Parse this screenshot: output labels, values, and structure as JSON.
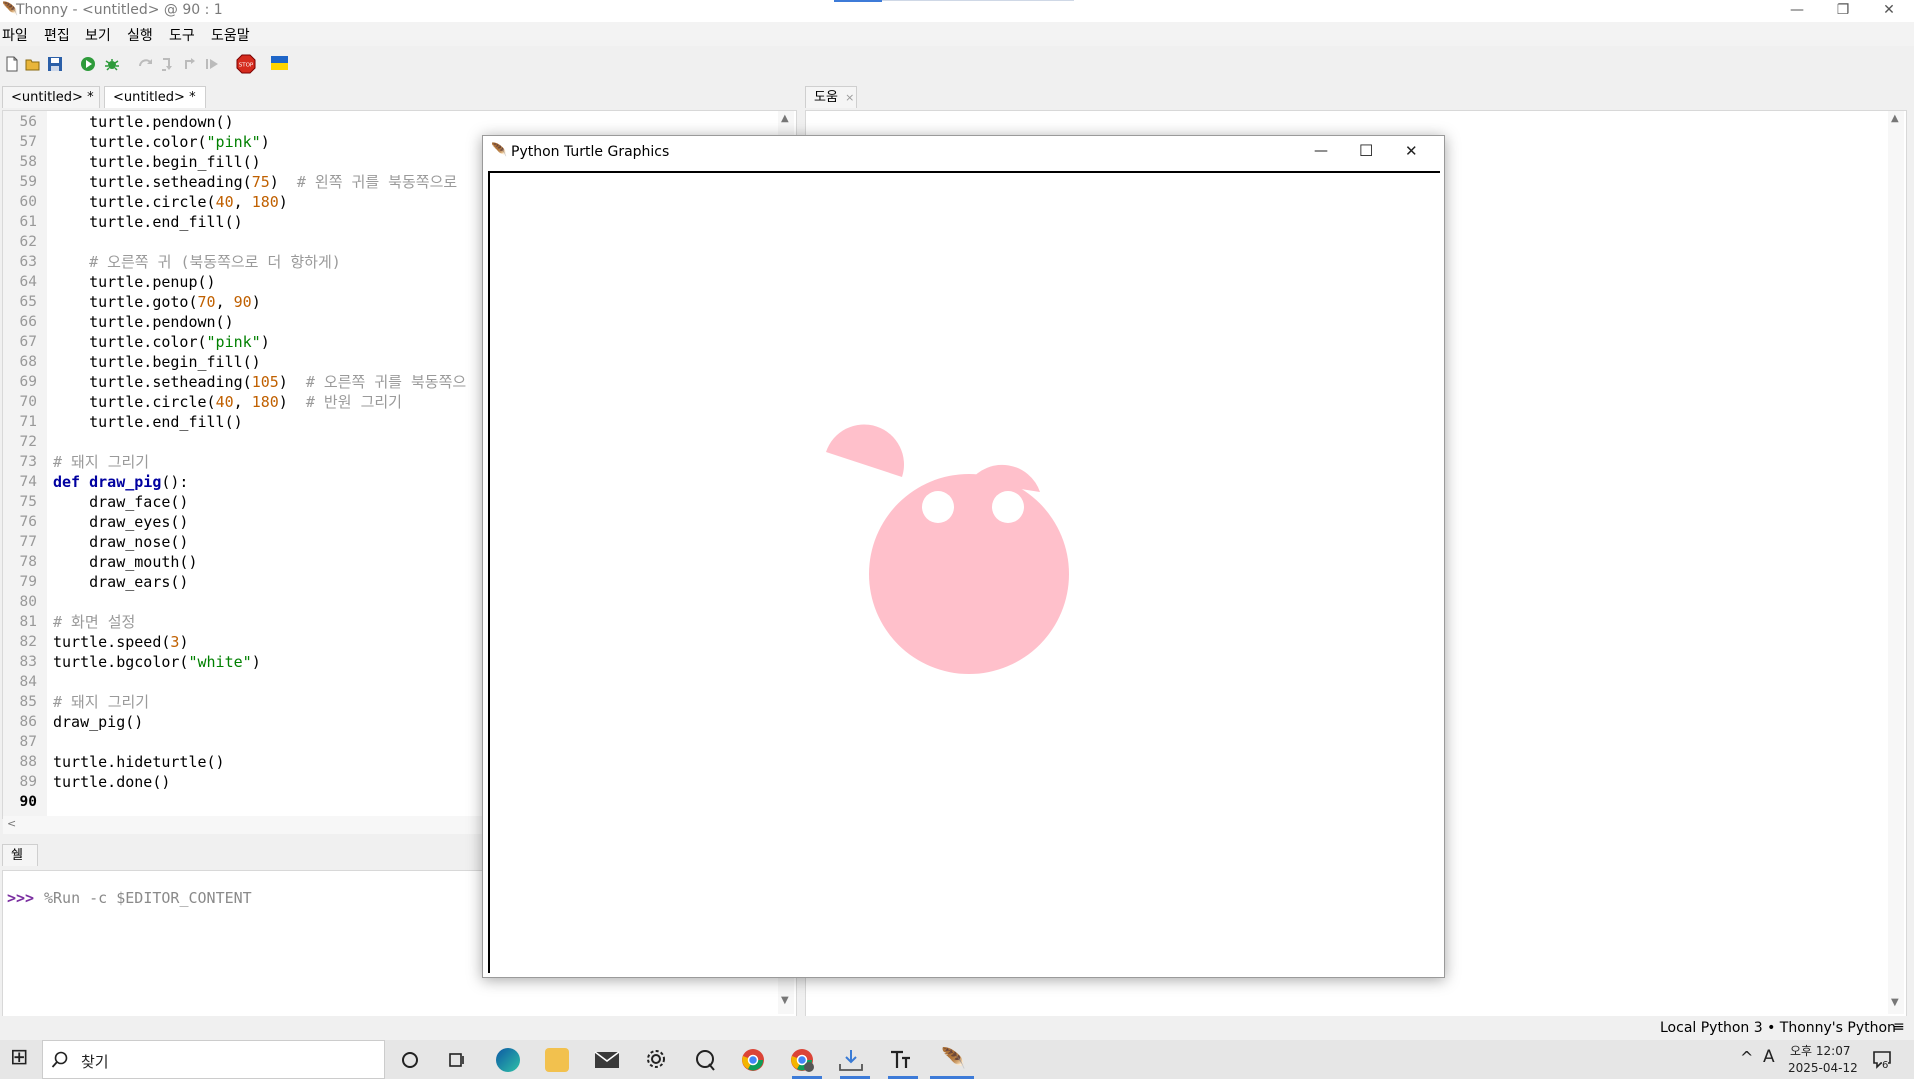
{
  "window": {
    "title": "Thonny  -  <untitled>  @  90 : 1",
    "minimize": "—",
    "restore": "❐",
    "close": "✕"
  },
  "menu": [
    "파일",
    "편집",
    "보기",
    "실행",
    "도구",
    "도움말"
  ],
  "toolbar": {
    "icons": [
      "new-file-icon",
      "open-file-icon",
      "save-icon",
      "run-icon",
      "debug-icon",
      "step-over-icon",
      "step-into-icon",
      "step-out-icon",
      "resume-icon",
      "stop-icon",
      "ukraine-flag-icon"
    ],
    "stop_text": "STOP"
  },
  "editor_tabs": [
    {
      "label": "<untitled> *",
      "close": "×"
    },
    {
      "label": "<untitled> *",
      "close": "×"
    }
  ],
  "help_tab": {
    "label": "도움",
    "close": "×"
  },
  "editor": {
    "lines": [
      {
        "n": "56",
        "html": "    turtle.pendown()"
      },
      {
        "n": "57",
        "html": "    turtle.color(<span class='str'>\"pink\"</span>)"
      },
      {
        "n": "58",
        "html": "    turtle.begin_fill()"
      },
      {
        "n": "59",
        "html": "    turtle.setheading(<span class='num'>75</span>)  <span class='com'># 왼쪽 귀를 북동쪽으로</span>"
      },
      {
        "n": "60",
        "html": "    turtle.circle(<span class='num'>40</span>, <span class='num'>180</span>)"
      },
      {
        "n": "61",
        "html": "    turtle.end_fill()"
      },
      {
        "n": "62",
        "html": ""
      },
      {
        "n": "63",
        "html": "    <span class='com'># 오른쪽 귀 (북동쪽으로 더 향하게)</span>"
      },
      {
        "n": "64",
        "html": "    turtle.penup()"
      },
      {
        "n": "65",
        "html": "    turtle.goto(<span class='num'>70</span>, <span class='num'>90</span>)"
      },
      {
        "n": "66",
        "html": "    turtle.pendown()"
      },
      {
        "n": "67",
        "html": "    turtle.color(<span class='str'>\"pink\"</span>)"
      },
      {
        "n": "68",
        "html": "    turtle.begin_fill()"
      },
      {
        "n": "69",
        "html": "    turtle.setheading(<span class='num'>105</span>)  <span class='com'># 오른쪽 귀를 북동쪽으</span>"
      },
      {
        "n": "70",
        "html": "    turtle.circle(<span class='num'>40</span>, <span class='num'>180</span>)  <span class='com'># 반원 그리기</span>"
      },
      {
        "n": "71",
        "html": "    turtle.end_fill()"
      },
      {
        "n": "72",
        "html": ""
      },
      {
        "n": "73",
        "html": "<span class='com'># 돼지 그리기</span>"
      },
      {
        "n": "74",
        "html": "<span class='kw'>def</span> <span class='fn'>draw_pig</span>():"
      },
      {
        "n": "75",
        "html": "    draw_face()"
      },
      {
        "n": "76",
        "html": "    draw_eyes()"
      },
      {
        "n": "77",
        "html": "    draw_nose()"
      },
      {
        "n": "78",
        "html": "    draw_mouth()"
      },
      {
        "n": "79",
        "html": "    draw_ears()"
      },
      {
        "n": "80",
        "html": ""
      },
      {
        "n": "81",
        "html": "<span class='com'># 화면 설정</span>"
      },
      {
        "n": "82",
        "html": "turtle.speed(<span class='num'>3</span>)"
      },
      {
        "n": "83",
        "html": "turtle.bgcolor(<span class='str'>\"white\"</span>)"
      },
      {
        "n": "84",
        "html": ""
      },
      {
        "n": "85",
        "html": "<span class='com'># 돼지 그리기</span>"
      },
      {
        "n": "86",
        "html": "draw_pig()"
      },
      {
        "n": "87",
        "html": ""
      },
      {
        "n": "88",
        "html": "turtle.hideturtle()"
      },
      {
        "n": "89",
        "html": "turtle.done()"
      },
      {
        "n": "90",
        "html": ""
      }
    ]
  },
  "shell_tab": {
    "label": "쉘",
    "close": "×"
  },
  "shell": {
    "prompt": ">>>",
    "command": "%Run -c $EDITOR_CONTENT"
  },
  "turtle_window": {
    "title": "Python Turtle Graphics",
    "minimize": "—",
    "maximize": "☐",
    "close": "✕",
    "pig_color": "#ffc0cb"
  },
  "statusbar": {
    "interpreter": "Local Python 3  •  Thonny's Python",
    "menu": "≡"
  },
  "taskbar": {
    "start": "⊞",
    "search_placeholder": "찾기",
    "search_icon": "search-icon",
    "time": "오후 12:07",
    "date": "2025-04-12",
    "ime": "A",
    "tray_arrow": "^",
    "notifications": "6"
  }
}
